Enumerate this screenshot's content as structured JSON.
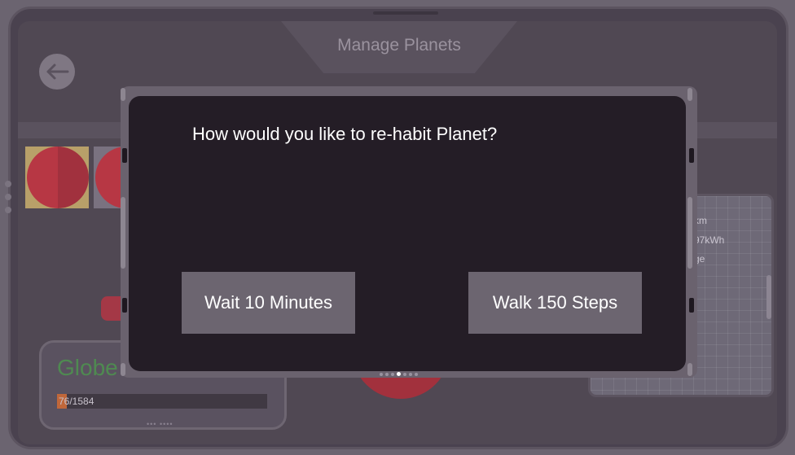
{
  "header": {
    "title": "Manage Planets"
  },
  "background": {
    "globe_label": "Globe",
    "progress_text": "76/1584",
    "progress_fraction": 0.048,
    "stats_lines": [
      "km",
      "97kWh",
      "ge"
    ]
  },
  "dialog": {
    "question": "How would you like to re-habit Planet?",
    "option_wait": "Wait 10 Minutes",
    "option_walk": "Walk 150 Steps"
  },
  "pager": {
    "count": 7,
    "active": 3
  },
  "icons": {
    "back": "arrow-left-icon"
  },
  "colors": {
    "dialog_bg": "#241d26",
    "button_bg": "#6c6570",
    "planet_red": "#b73744",
    "globe_green": "#4f8a51"
  }
}
